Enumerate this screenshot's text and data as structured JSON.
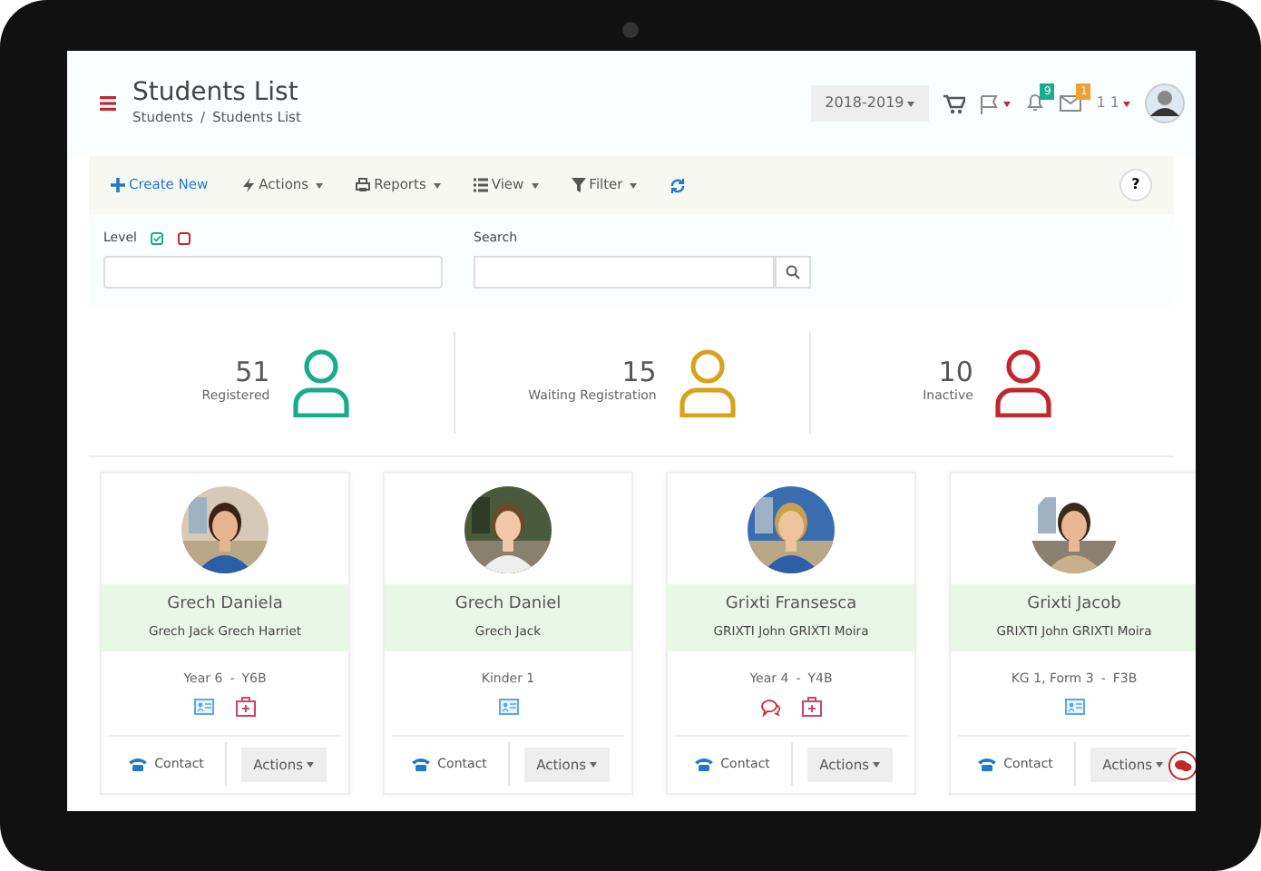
{
  "header": {
    "title": "Students List",
    "breadcrumb": [
      "Students",
      "Students List"
    ],
    "breadcrumb_separator": "/",
    "year": "2018-2019",
    "notification_count": "9",
    "message_count": "1",
    "user": "1 1"
  },
  "toolbar": [
    {
      "label": "Create New",
      "has_menu": false
    },
    {
      "label": "Actions",
      "has_menu": true
    },
    {
      "label": "Reports",
      "has_menu": true
    },
    {
      "label": "View",
      "has_menu": true
    },
    {
      "label": "Filter",
      "has_menu": true
    }
  ],
  "help": "?",
  "filters": {
    "level_label": "Level",
    "level_options": [
      {
        "checked": true,
        "color": "#1aab8a"
      },
      {
        "checked": false,
        "color": "#c0282d"
      }
    ],
    "search_label": "Search"
  },
  "stats": [
    {
      "count": "51",
      "label": "Registered",
      "color": "#1aab8a"
    },
    {
      "count": "15",
      "label": "Waiting Registration",
      "color": "#d9a21b"
    },
    {
      "count": "10",
      "label": "Inactive",
      "color": "#c0282d"
    }
  ],
  "students": [
    {
      "name": "Grech Daniela",
      "parents": "Grech Jack Grech Harriet",
      "level": "Year 6",
      "separator": "-",
      "class": "Y6B",
      "badges": [
        {
          "kind": "id-card"
        },
        {
          "kind": "medical"
        }
      ],
      "contact": "Contact",
      "actions": "Actions"
    },
    {
      "name": "Grech Daniel",
      "parents": "Grech Jack",
      "level": "Kinder 1",
      "badges": [
        {
          "kind": "id-card"
        }
      ],
      "contact": "Contact",
      "actions": "Actions"
    },
    {
      "name": "Grixti Fransesca",
      "parents": "GRIXTI John GRIXTI Moira",
      "level": "Year 4",
      "separator": "-",
      "class": "Y4B",
      "badges": [
        {
          "kind": "chat"
        },
        {
          "kind": "medical"
        }
      ],
      "contact": "Contact",
      "actions": "Actions"
    },
    {
      "name": "Grixti Jacob",
      "parents": "GRIXTI John GRIXTI Moira",
      "level": "KG 1, Form 3",
      "separator": "-",
      "class": "F3B",
      "badges": [
        {
          "kind": "id-card"
        }
      ],
      "contact": "Contact",
      "actions": "Actions"
    }
  ]
}
